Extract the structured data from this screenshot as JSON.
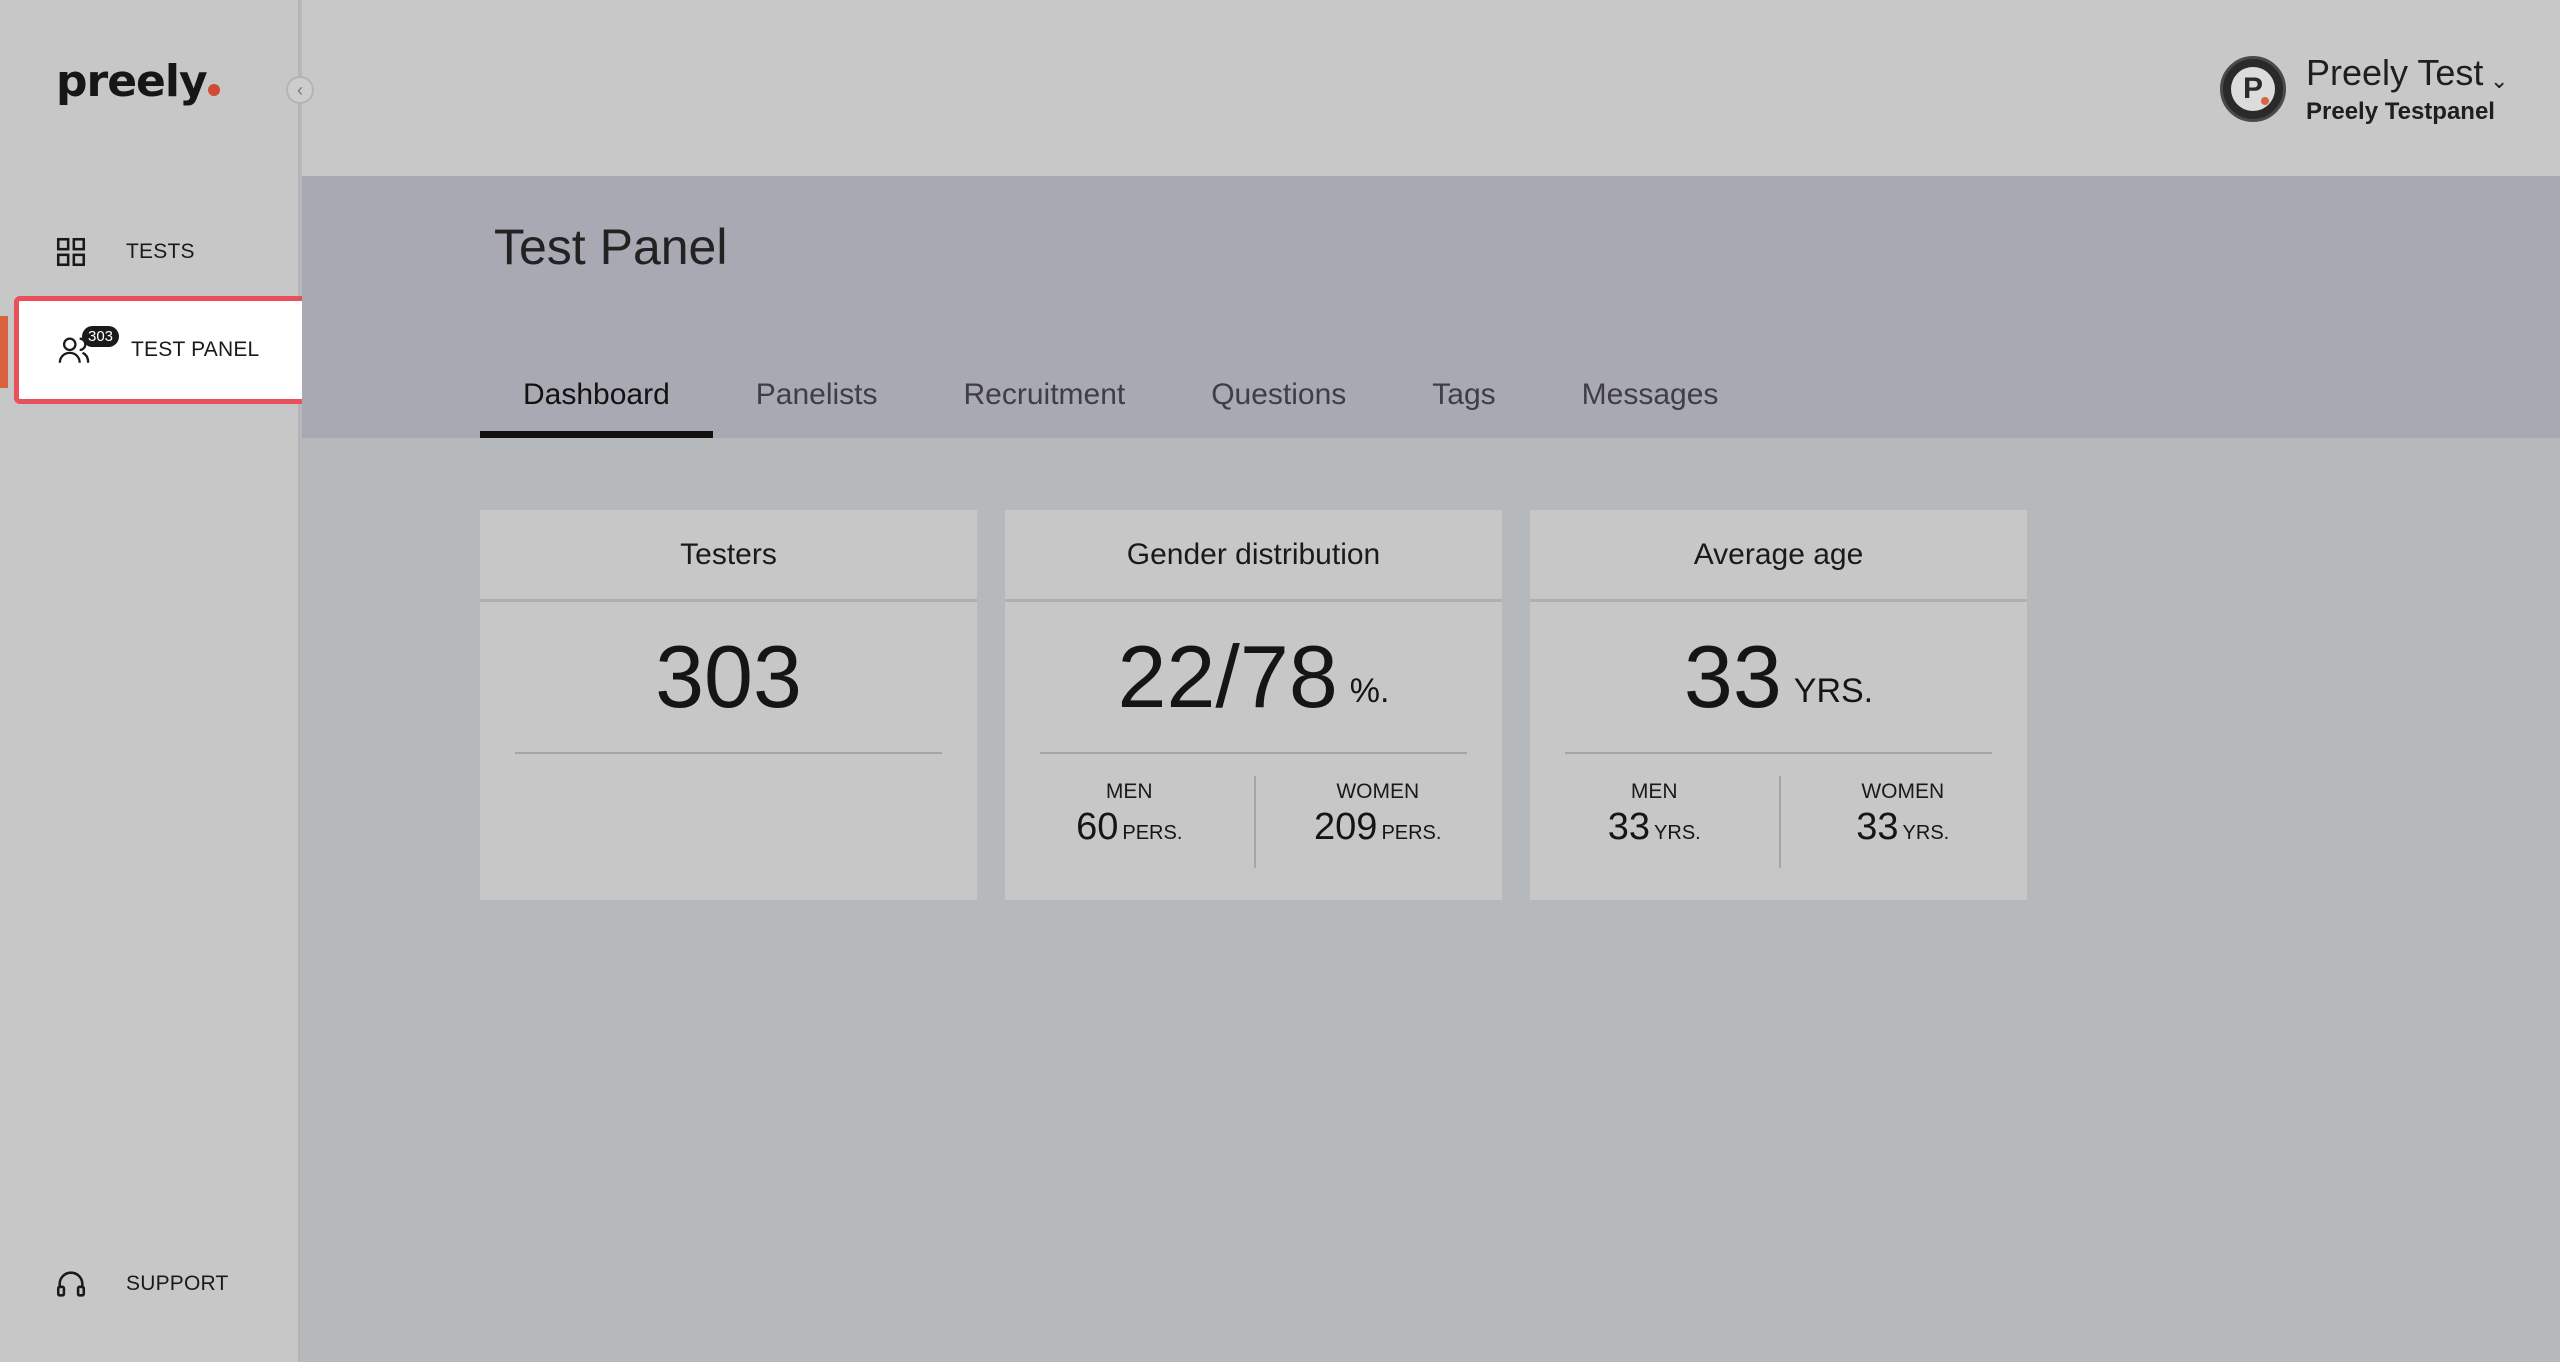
{
  "sidebar": {
    "logo": "preely",
    "items": [
      {
        "label": "TESTS",
        "icon": "grid-icon"
      },
      {
        "label": "TEST PANEL",
        "icon": "users-icon",
        "badge": "303"
      },
      {
        "label": "SUPPORT",
        "icon": "headset-icon"
      }
    ],
    "collapse_icon": "chevron-left-icon"
  },
  "header": {
    "user_name": "Preely Test",
    "user_sub": "Preely Testpanel",
    "avatar_letter": "P",
    "chevron": "chevron-down-icon"
  },
  "page": {
    "title": "Test Panel",
    "tabs": [
      "Dashboard",
      "Panelists",
      "Recruitment",
      "Questions",
      "Tags",
      "Messages"
    ],
    "active_tab": "Dashboard"
  },
  "cards": {
    "testers": {
      "title": "Testers",
      "value": "303"
    },
    "gender": {
      "title": "Gender distribution",
      "value": "22/78",
      "unit": "%.",
      "men_label": "MEN",
      "men_value": "60",
      "men_unit": "PERS.",
      "women_label": "WOMEN",
      "women_value": "209",
      "women_unit": "PERS."
    },
    "age": {
      "title": "Average age",
      "value": "33",
      "unit": "YRS.",
      "men_label": "MEN",
      "men_value": "33",
      "men_unit": "YRS.",
      "women_label": "WOMEN",
      "women_value": "33",
      "women_unit": "YRS."
    }
  },
  "colors": {
    "accent": "#d9623f",
    "highlight": "#e8505b"
  }
}
